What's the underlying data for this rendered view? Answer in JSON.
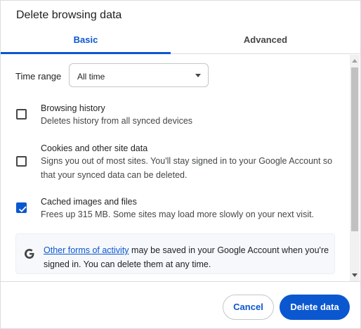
{
  "dialog": {
    "title": "Delete browsing data"
  },
  "tabs": [
    {
      "label": "Basic",
      "selected": true
    },
    {
      "label": "Advanced",
      "selected": false
    }
  ],
  "time_range": {
    "label": "Time range",
    "selected": "All time"
  },
  "options": [
    {
      "title": "Browsing history",
      "desc": "Deletes history from all synced devices",
      "checked": false
    },
    {
      "title": "Cookies and other site data",
      "desc": "Signs you out of most sites. You'll stay signed in to your Google Account so that your synced data can be deleted.",
      "checked": false
    },
    {
      "title": "Cached images and files",
      "desc": "Frees up 315 MB. Some sites may load more slowly on your next visit.",
      "checked": true
    }
  ],
  "info": {
    "icon": "google-g-icon",
    "link_text": "Other forms of activity",
    "text": " may be saved in your Google Account when you're signed in. You can delete them at any time."
  },
  "buttons": {
    "cancel": "Cancel",
    "delete": "Delete data"
  },
  "colors": {
    "accent": "#0b57d0",
    "text": "#1f1f1f",
    "secondary_text": "#444746"
  }
}
